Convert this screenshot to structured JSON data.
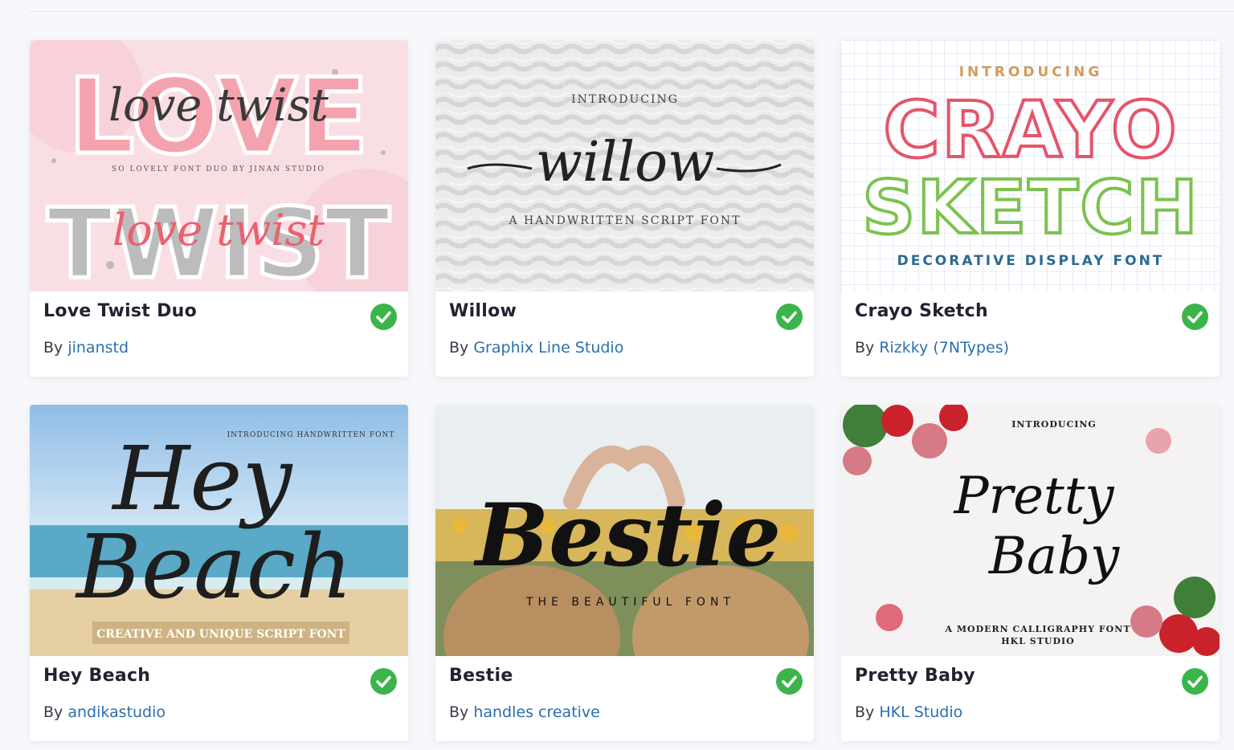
{
  "colors": {
    "accent_link": "#2a6fb0",
    "verified_green": "#3bb54a",
    "title_text": "#222330"
  },
  "cards": [
    {
      "title": "Love Twist Duo",
      "by_label": "By",
      "author": "jinanstd",
      "verified_icon": "check-circle-icon",
      "preview": {
        "word1": "LOVE",
        "script1": "love twist",
        "tagline": "SO LOVELY FONT DUO BY JINAN STUDIO",
        "word2": "TWIST",
        "script2": "love twist"
      }
    },
    {
      "title": "Willow",
      "by_label": "By",
      "author": "Graphix Line Studio",
      "verified_icon": "check-circle-icon",
      "preview": {
        "intro": "INTRODUCING",
        "name": "willow",
        "tagline": "A HANDWRITTEN SCRIPT FONT"
      }
    },
    {
      "title": "Crayo Sketch",
      "by_label": "By",
      "author": "Rizkky (7NTypes)",
      "verified_icon": "check-circle-icon",
      "preview": {
        "intro": "INTRODUCING",
        "word1": "CRAYO",
        "word2": "SKETCH",
        "tagline": "DECORATIVE DISPLAY FONT"
      }
    },
    {
      "title": "Hey Beach",
      "by_label": "By",
      "author": "andikastudio",
      "verified_icon": "check-circle-icon",
      "preview": {
        "line1": "Hey",
        "line2": "Beach",
        "arc": "INTRODUCING HANDWRITTEN FONT",
        "tagline": "CREATIVE AND UNIQUE SCRIPT FONT"
      }
    },
    {
      "title": "Bestie",
      "by_label": "By",
      "author": "handles creative",
      "verified_icon": "check-circle-icon",
      "preview": {
        "name": "Bestie",
        "tagline": "THE BEAUTIFUL FONT"
      }
    },
    {
      "title": "Pretty Baby",
      "by_label": "By",
      "author": "HKL Studio",
      "verified_icon": "check-circle-icon",
      "preview": {
        "intro": "INTRODUCING",
        "line1": "Pretty",
        "line2": "Baby",
        "tagline": "A MODERN CALLIGRAPHY FONT",
        "studio": "HKL STUDIO"
      }
    }
  ]
}
